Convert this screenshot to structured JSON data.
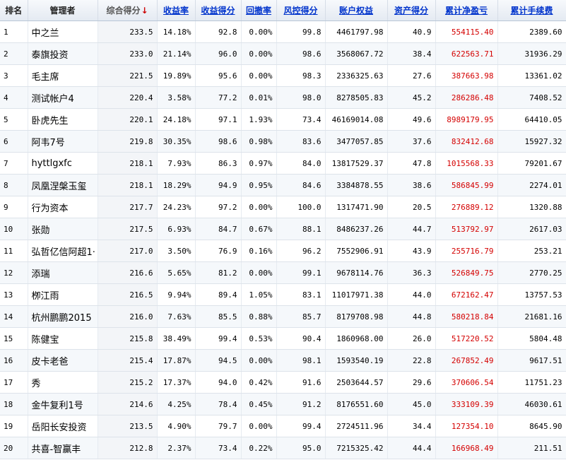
{
  "table": {
    "headers": [
      "排名",
      "管理者",
      "综合得分",
      "收益率",
      "收益得分",
      "回撤率",
      "风控得分",
      "账户权益",
      "资产得分",
      "累计净盈亏",
      "累计手续费"
    ],
    "sort_arrow": "↓",
    "rows": [
      [
        "1",
        "中之兰",
        "233.5",
        "14.18%",
        "92.8",
        "0.00%",
        "99.8",
        "4461797.98",
        "40.9",
        "554115.40",
        "2389.60"
      ],
      [
        "2",
        "泰旗投资",
        "233.0",
        "21.14%",
        "96.0",
        "0.00%",
        "98.6",
        "3568067.72",
        "38.4",
        "622563.71",
        "31936.29"
      ],
      [
        "3",
        "毛主席",
        "221.5",
        "19.89%",
        "95.6",
        "0.00%",
        "98.3",
        "2336325.63",
        "27.6",
        "387663.98",
        "13361.02"
      ],
      [
        "4",
        "测试帐户4",
        "220.4",
        "3.58%",
        "77.2",
        "0.01%",
        "98.0",
        "8278505.83",
        "45.2",
        "286286.48",
        "7408.52"
      ],
      [
        "5",
        "卧虎先生",
        "220.1",
        "24.18%",
        "97.1",
        "1.93%",
        "73.4",
        "46169014.08",
        "49.6",
        "8989179.95",
        "64410.05"
      ],
      [
        "6",
        "阿韦7号",
        "219.8",
        "30.35%",
        "98.6",
        "0.98%",
        "83.6",
        "3477057.85",
        "37.6",
        "832412.68",
        "15927.32"
      ],
      [
        "7",
        "hyttlgxfc",
        "218.1",
        "7.93%",
        "86.3",
        "0.97%",
        "84.0",
        "13817529.37",
        "47.8",
        "1015568.33",
        "79201.67"
      ],
      [
        "8",
        "凤凰涅槃玉玺",
        "218.1",
        "18.29%",
        "94.9",
        "0.95%",
        "84.6",
        "3384878.55",
        "38.6",
        "586845.99",
        "2274.01"
      ],
      [
        "9",
        "行为资本",
        "217.7",
        "24.23%",
        "97.2",
        "0.00%",
        "100.0",
        "1317471.90",
        "20.5",
        "276889.12",
        "1320.88"
      ],
      [
        "10",
        "张勋",
        "217.5",
        "6.93%",
        "84.7",
        "0.67%",
        "88.1",
        "8486237.26",
        "44.7",
        "513792.97",
        "2617.03"
      ],
      [
        "11",
        "弘哲亿信阿超1·",
        "217.0",
        "3.50%",
        "76.9",
        "0.16%",
        "96.2",
        "7552906.91",
        "43.9",
        "255716.79",
        "253.21"
      ],
      [
        "12",
        "添瑞",
        "216.6",
        "5.65%",
        "81.2",
        "0.00%",
        "99.1",
        "9678114.76",
        "36.3",
        "526849.75",
        "2770.25"
      ],
      [
        "13",
        "栁江雨",
        "216.5",
        "9.94%",
        "89.4",
        "1.05%",
        "83.1",
        "11017971.38",
        "44.0",
        "672162.47",
        "13757.53"
      ],
      [
        "14",
        "杭州鹏鹏2015",
        "216.0",
        "7.63%",
        "85.5",
        "0.88%",
        "85.7",
        "8179708.98",
        "44.8",
        "580218.84",
        "21681.16"
      ],
      [
        "15",
        "陈健宝",
        "215.8",
        "38.49%",
        "99.4",
        "0.53%",
        "90.4",
        "1860968.00",
        "26.0",
        "517220.52",
        "5804.48"
      ],
      [
        "16",
        "皮卡老爸",
        "215.4",
        "17.87%",
        "94.5",
        "0.00%",
        "98.1",
        "1593540.19",
        "22.8",
        "267852.49",
        "9617.51"
      ],
      [
        "17",
        "秀",
        "215.2",
        "17.37%",
        "94.0",
        "0.42%",
        "91.6",
        "2503644.57",
        "29.6",
        "370606.54",
        "11751.23"
      ],
      [
        "18",
        "金牛复利1号",
        "214.6",
        "4.25%",
        "78.4",
        "0.45%",
        "91.2",
        "8176551.60",
        "45.0",
        "333109.39",
        "46030.61"
      ],
      [
        "19",
        "岳阳长安投资",
        "213.5",
        "4.90%",
        "79.7",
        "0.00%",
        "99.4",
        "2724511.96",
        "34.4",
        "127354.10",
        "8645.90"
      ],
      [
        "20",
        "共喜-智赢丰",
        "212.8",
        "2.37%",
        "73.4",
        "0.22%",
        "95.0",
        "7215325.42",
        "44.4",
        "166968.49",
        "211.51"
      ]
    ]
  },
  "colors": {
    "link": "#0033cc",
    "profit_red": "#d40000",
    "sort_arrow": "#cc0000"
  }
}
